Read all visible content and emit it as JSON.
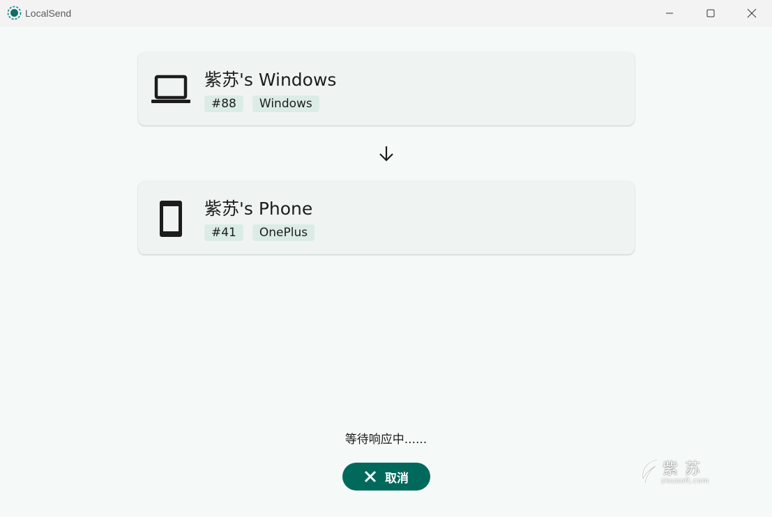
{
  "window": {
    "title": "LocalSend",
    "controls": {
      "minimize_icon": "minimize-icon",
      "maximize_icon": "maximize-icon",
      "close_icon": "close-icon"
    }
  },
  "colors": {
    "accent": "#00695c",
    "card_background": "#eff4f2",
    "tag_background": "#dbece7",
    "page_background": "#f5f9f8",
    "titlebar": "#f3f3f3"
  },
  "sender": {
    "icon": "laptop-icon",
    "name": "紫苏's Windows",
    "tags": [
      "#88",
      "Windows"
    ]
  },
  "direction_icon": "arrow-down-icon",
  "receiver": {
    "icon": "phone-icon",
    "name": "紫苏's Phone",
    "tags": [
      "#41",
      "OnePlus"
    ]
  },
  "status": {
    "text": "等待响应中......"
  },
  "cancel_button": {
    "icon": "close-icon",
    "label": "取消"
  },
  "watermark": {
    "text": "紫苏",
    "subtext": "zisusoft.com"
  }
}
